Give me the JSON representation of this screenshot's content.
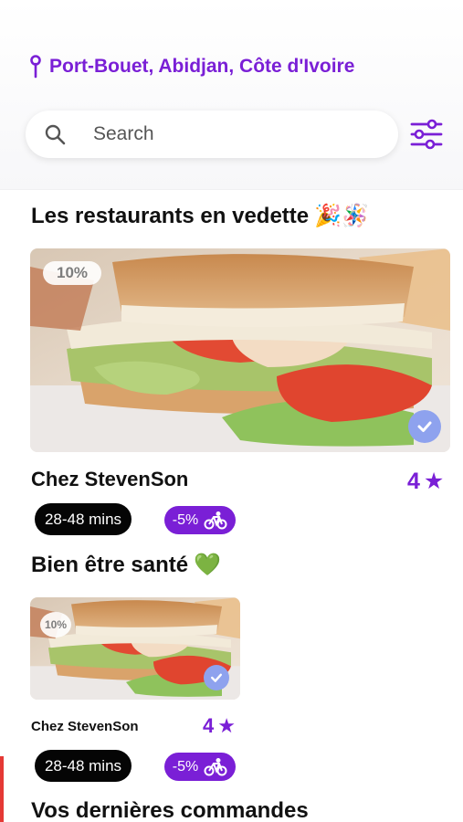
{
  "location": {
    "text": "Port-Bouet, Abidjan, Côte d'Ivoire",
    "icon": "pin-icon"
  },
  "search": {
    "placeholder": "Search",
    "icon": "search-icon"
  },
  "filter": {
    "icon": "sliders-icon"
  },
  "featured": {
    "title": "Les restaurants en vedette",
    "emoji": "🎉🪅",
    "card": {
      "discount": "10%",
      "name": "Chez StevenSon",
      "rating": "4",
      "rating_icon": "★",
      "time": "28-48 mins",
      "promo": "-5%"
    }
  },
  "healthy": {
    "title": "Bien être santé",
    "emoji": "💚",
    "card": {
      "discount": "10%",
      "name": "Chez StevenSon",
      "rating": "4",
      "rating_icon": "★",
      "time": "28-48 mins",
      "promo": "-5%"
    }
  },
  "orders": {
    "title": "Vos dernières commandes"
  },
  "colors": {
    "accent": "#7a1fd6",
    "verified": "#8ea2ee",
    "pill_dark": "#050505"
  }
}
